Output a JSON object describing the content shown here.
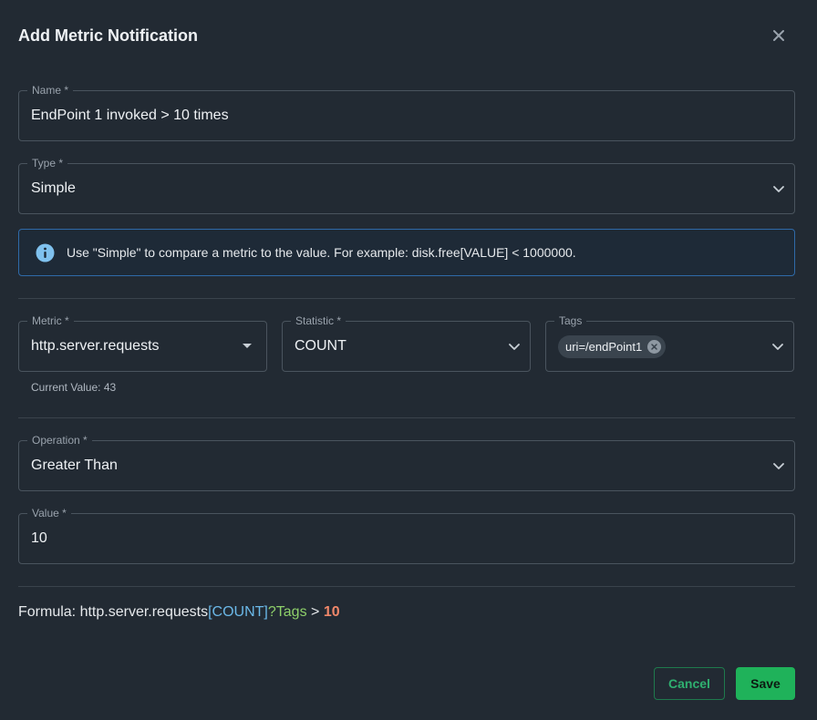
{
  "dialog": {
    "title": "Add Metric Notification",
    "close_icon": "close-icon"
  },
  "name_field": {
    "label": "Name *",
    "value": "EndPoint 1 invoked > 10 times"
  },
  "type_field": {
    "label": "Type *",
    "value": "Simple"
  },
  "info": {
    "icon": "info-icon",
    "text": "Use \"Simple\" to compare a metric to the value. For example: disk.free[VALUE] < 1000000."
  },
  "metric_field": {
    "label": "Metric *",
    "value": "http.server.requests",
    "helper": "Current Value: 43"
  },
  "statistic_field": {
    "label": "Statistic *",
    "value": "COUNT"
  },
  "tags_field": {
    "label": "Tags",
    "chips": [
      "uri=/endPoint1"
    ]
  },
  "operation_field": {
    "label": "Operation *",
    "value": "Greater Than"
  },
  "value_field": {
    "label": "Value *",
    "value": "10"
  },
  "formula": {
    "prefix": "Formula: ",
    "metric": "http.server.requests",
    "statistic": "[COUNT]",
    "tags": "?Tags",
    "operator": " > ",
    "value": "10"
  },
  "actions": {
    "cancel": "Cancel",
    "save": "Save"
  },
  "colors": {
    "background": "#222a33",
    "border": "#4a545e",
    "info_border": "#2f6aa8",
    "accent_green": "#1fb25a",
    "formula_stat": "#6bb8e8",
    "formula_tags": "#8ed06a",
    "formula_value": "#f0876a"
  }
}
